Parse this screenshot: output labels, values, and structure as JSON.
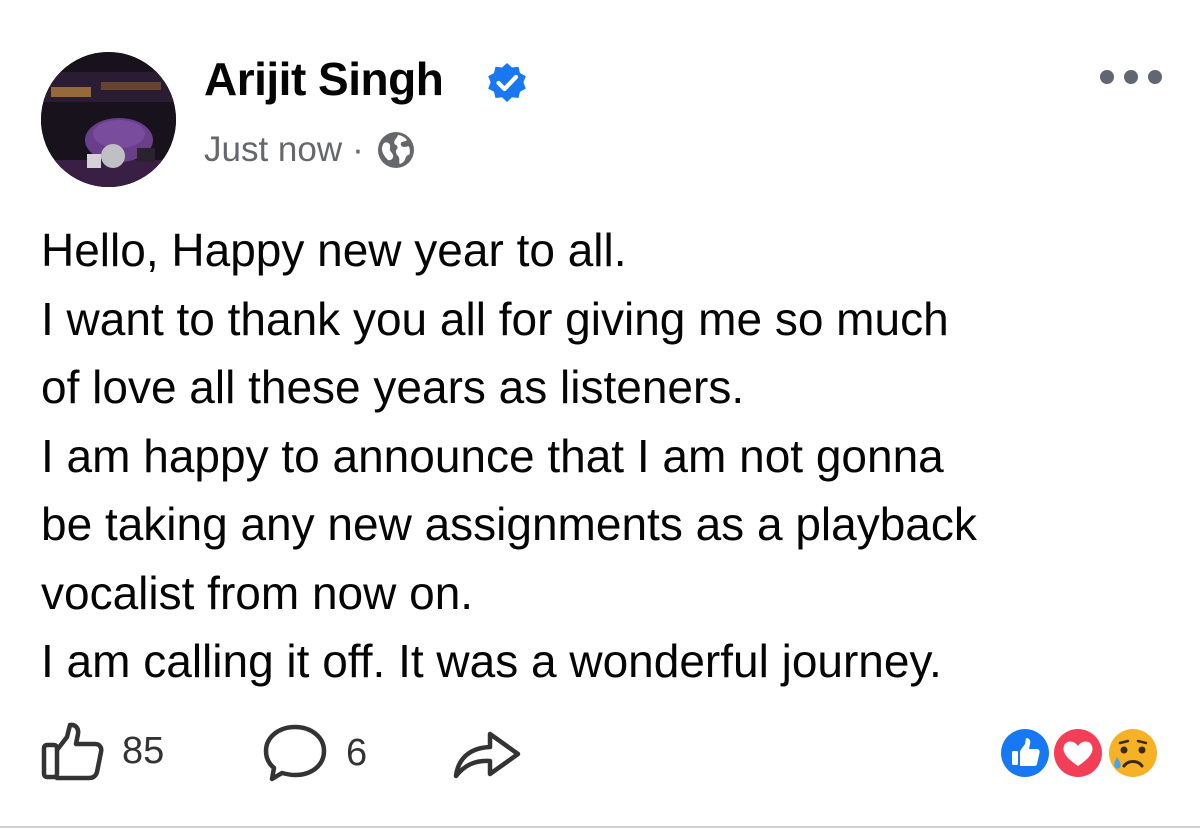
{
  "post": {
    "author_name": "Arijit Singh",
    "timestamp": "Just now",
    "separator": "·",
    "audience_icon": "globe-icon",
    "verified_icon": "verified-badge-icon",
    "more_icon": "more-options-icon",
    "text_lines": [
      "Hello, Happy new year to all.",
      "I want to thank you all for giving me so much",
      "of love all these years as listeners.",
      "I am happy to announce that I am not gonna",
      "be taking any new assignments as a playback",
      "vocalist from now on.",
      "I am calling it off. It was a wonderful journey."
    ]
  },
  "actions": {
    "like_count": "85",
    "comment_count": "6",
    "like_icon": "thumbs-up-icon",
    "comment_icon": "comment-bubble-icon",
    "share_icon": "share-arrow-icon"
  },
  "reactions": {
    "types": [
      "like",
      "love",
      "sad"
    ],
    "colors": {
      "like": "#1877f2",
      "love": "#f33e58",
      "sad": "#f7b125"
    }
  },
  "colors": {
    "text": "#050505",
    "secondary_text": "#65676b",
    "verified_badge": "#1877f2"
  }
}
